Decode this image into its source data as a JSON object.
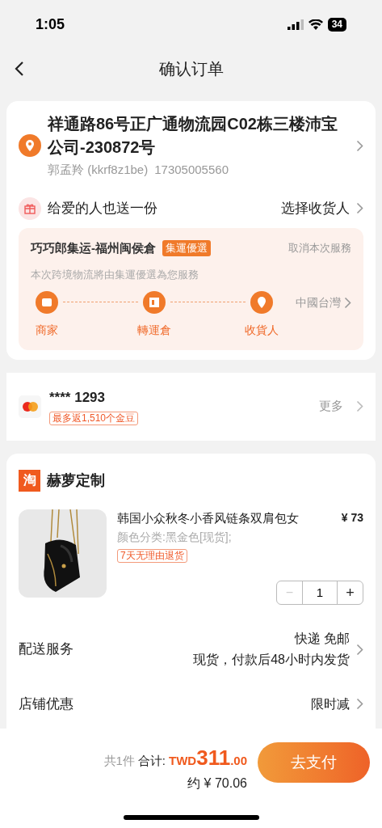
{
  "status_bar": {
    "time": "1:05",
    "battery": "34"
  },
  "header": {
    "title": "确认订单"
  },
  "address": {
    "line": "祥通路86号正广通物流园C02栋三楼沛宝公司-230872号",
    "contact": "郭孟羚 (kkrf8z1be)",
    "phone": "17305005560"
  },
  "gift": {
    "label": "给爱的人也送一份",
    "action": "选择收货人"
  },
  "consolidation": {
    "name": "巧巧郎集运-福州闽侯倉",
    "badge": "集運優選",
    "cancel": "取消本次服務",
    "note": "本次跨境物流將由集運優選為您服務",
    "destination": "中國台灣",
    "steps": [
      {
        "kind": "store",
        "label": "商家"
      },
      {
        "kind": "warehouse",
        "label": "轉運倉"
      },
      {
        "kind": "pin",
        "label": "收貨人"
      }
    ]
  },
  "payment": {
    "card": "**** 1293",
    "reward": "最多返1,510个金豆",
    "more": "更多"
  },
  "shop": {
    "name": "赫萝定制",
    "logo": "淘",
    "item": {
      "kind": "picture",
      "title": "韩国小众秋冬小香风链条双肩包女",
      "price": "¥ 73",
      "variant": "颜色分类:黑金色[现货];",
      "tag": "7天无理由退货",
      "minus": "−",
      "quantity": "1",
      "plus": "+"
    },
    "rows": [
      {
        "label": "配送服务",
        "lines": [
          "快递 免邮",
          "现货，付款后48小时内发货"
        ]
      },
      {
        "label": "店铺优惠",
        "lines": [
          "限时减"
        ]
      }
    ]
  },
  "footer": {
    "count": "共1件",
    "total_label": "合计:",
    "currency": "TWD",
    "amount": "311",
    "cents": ".00",
    "approx": "约 ¥ 70.06",
    "pay": "去支付"
  }
}
